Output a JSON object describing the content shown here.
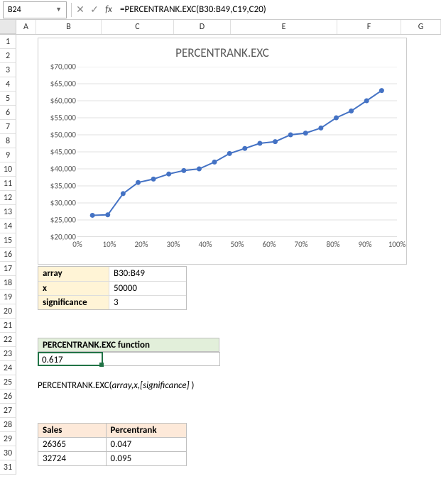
{
  "formula_bar": {
    "cell_ref": "B24",
    "formula": "=PERCENTRANK.EXC(B30:B49,C19,C20)"
  },
  "columns": [
    "A",
    "B",
    "C",
    "D",
    "E",
    "F",
    "G"
  ],
  "rows": [
    "1",
    "2",
    "3",
    "4",
    "5",
    "6",
    "7",
    "8",
    "9",
    "10",
    "11",
    "12",
    "13",
    "14",
    "15",
    "16",
    "17",
    "18",
    "19",
    "20",
    "21",
    "22",
    "23",
    "24",
    "25",
    "26",
    "27",
    "28",
    "29",
    "30",
    "31"
  ],
  "chart": {
    "title": "PERCENTRANK.EXC"
  },
  "chart_data": {
    "type": "line",
    "title": "PERCENTRANK.EXC",
    "xlabel": "",
    "ylabel": "",
    "y_ticks": [
      "$70,000",
      "$65,000",
      "$60,000",
      "$55,000",
      "$50,000",
      "$45,000",
      "$40,000",
      "$35,000",
      "$30,000",
      "$25,000",
      "$20,000"
    ],
    "x_ticks": [
      "0%",
      "10%",
      "20%",
      "30%",
      "40%",
      "50%",
      "60%",
      "70%",
      "80%",
      "90%",
      "100%"
    ],
    "ylim": [
      20000,
      70000
    ],
    "xlim": [
      0,
      1
    ],
    "points": [
      {
        "x": 0.047,
        "y": 26365
      },
      {
        "x": 0.095,
        "y": 26500
      },
      {
        "x": 0.143,
        "y": 32724
      },
      {
        "x": 0.19,
        "y": 36000
      },
      {
        "x": 0.238,
        "y": 37000
      },
      {
        "x": 0.286,
        "y": 38500
      },
      {
        "x": 0.333,
        "y": 39500
      },
      {
        "x": 0.381,
        "y": 40000
      },
      {
        "x": 0.429,
        "y": 42000
      },
      {
        "x": 0.476,
        "y": 44500
      },
      {
        "x": 0.524,
        "y": 46000
      },
      {
        "x": 0.571,
        "y": 47500
      },
      {
        "x": 0.619,
        "y": 48000
      },
      {
        "x": 0.667,
        "y": 50000
      },
      {
        "x": 0.714,
        "y": 50500
      },
      {
        "x": 0.762,
        "y": 52000
      },
      {
        "x": 0.81,
        "y": 55000
      },
      {
        "x": 0.857,
        "y": 57000
      },
      {
        "x": 0.905,
        "y": 60000
      },
      {
        "x": 0.952,
        "y": 63000
      }
    ]
  },
  "params": {
    "rows": [
      {
        "label": "array",
        "value": "B30:B49"
      },
      {
        "label": "x",
        "value": "50000"
      },
      {
        "label": "significance",
        "value": "3"
      }
    ]
  },
  "function": {
    "header": "PERCENTRANK.EXC function",
    "result": "0.617",
    "syntax_name": "PERCENTRANK.EXC(",
    "syntax_args": "array,x,[significance]",
    "syntax_end": " )"
  },
  "data_table": {
    "headers": [
      "Sales",
      "Percentrank"
    ],
    "rows": [
      {
        "sales": "26365",
        "pr": "0.047"
      },
      {
        "sales": "32724",
        "pr": "0.095"
      }
    ]
  }
}
